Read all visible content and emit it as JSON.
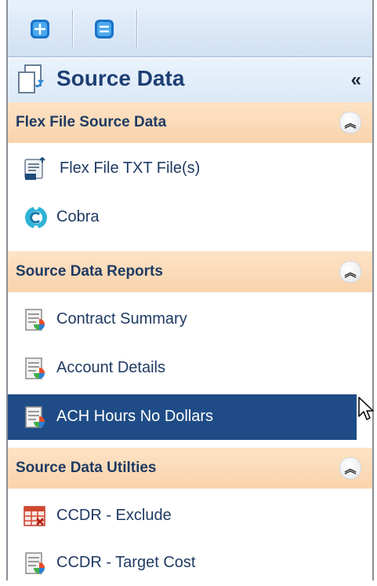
{
  "header": {
    "title": "Source Data",
    "collapse_label": "«"
  },
  "groups": [
    {
      "label": "Flex File Source Data",
      "items": [
        {
          "label": "Flex File TXT File(s)",
          "icon": "txt-file-icon"
        },
        {
          "label": "Cobra",
          "icon": "cobra-icon"
        }
      ]
    },
    {
      "label": "Source Data Reports",
      "items": [
        {
          "label": "Contract Summary",
          "icon": "report-icon"
        },
        {
          "label": "Account Details",
          "icon": "report-icon"
        },
        {
          "label": "ACH Hours No Dollars",
          "icon": "report-icon",
          "selected": true
        }
      ]
    },
    {
      "label": "Source Data Utilties",
      "items": [
        {
          "label": "CCDR - Exclude",
          "icon": "exclude-grid-icon"
        },
        {
          "label": "CCDR - Target Cost",
          "icon": "report-icon"
        }
      ]
    }
  ],
  "colors": {
    "group_header": "#f9d3ac",
    "selected_row": "#1f4c86",
    "title_text": "#1e3f74"
  }
}
